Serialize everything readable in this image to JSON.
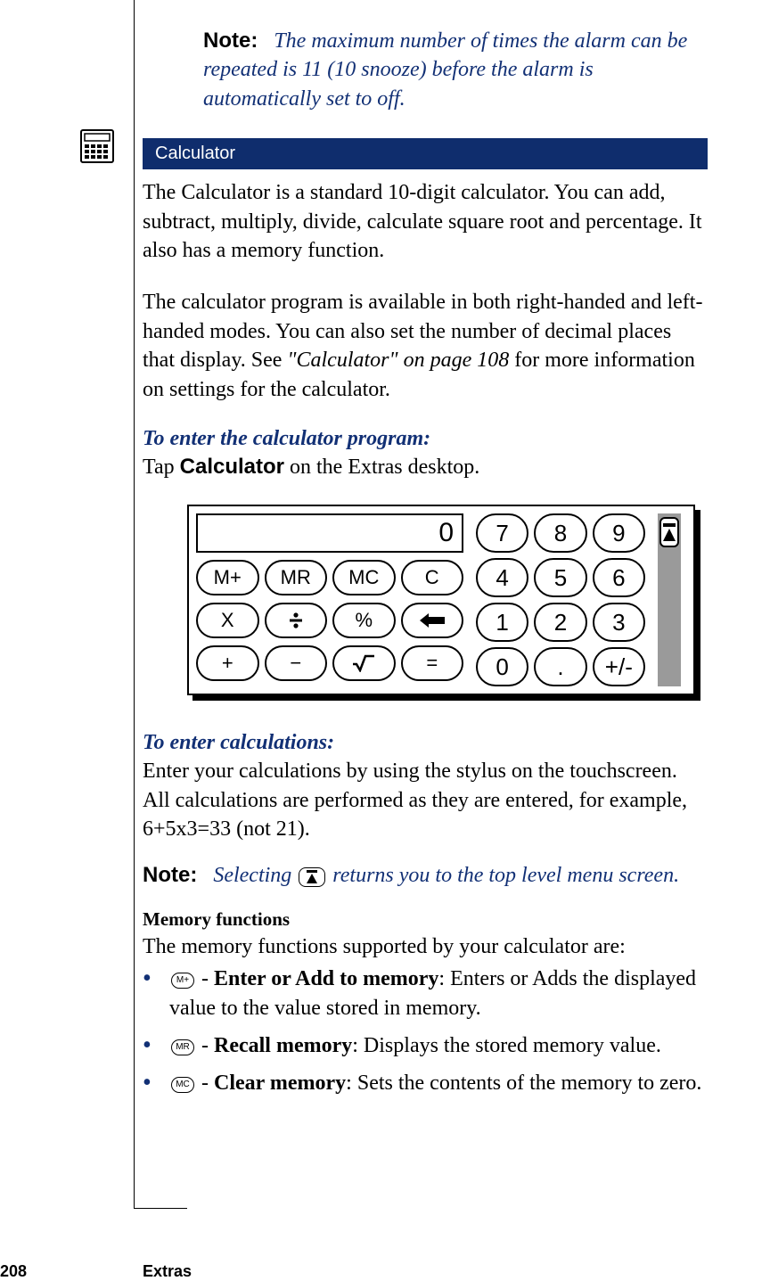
{
  "note1": {
    "label": "Note:",
    "text": "The maximum number of times the alarm can be repeated is 11 (10 snooze) before the alarm is automatically set to off."
  },
  "section": {
    "title": "Calculator"
  },
  "para1": "The Calculator is a standard 10-digit calculator. You can add, subtract, multiply, divide, calculate square root and percentage. It also has a memory function.",
  "para2_a": "The calculator program is available in both right-handed and left-handed modes. You can also set the number of decimal places that display. See ",
  "para2_ref": "\"Calculator\" on page 108",
  "para2_b": " for more information on settings for the calculator.",
  "sub1": "To enter the calculator program:",
  "instr1_a": "Tap ",
  "instr1_bold": "Calculator",
  "instr1_b": " on the Extras desktop.",
  "calc": {
    "display": "0",
    "row1": [
      "M+",
      "MR",
      "MC",
      "C"
    ],
    "row2_labels": [
      "multiply",
      "divide",
      "percent",
      "backspace"
    ],
    "row2_text": [
      "X",
      "",
      "%",
      ""
    ],
    "row3_labels": [
      "plus",
      "minus",
      "sqrt",
      "equals"
    ],
    "row3_text": [
      "+",
      "−",
      "",
      "="
    ],
    "numpad": [
      "7",
      "8",
      "9",
      "4",
      "5",
      "6",
      "1",
      "2",
      "3",
      "0",
      ".",
      "+/-"
    ]
  },
  "sub2": "To enter calculations:",
  "para3": "Enter your calculations by using the stylus on the touchscreen. All calculations are performed as they are entered, for example, 6+5x3=33 (not 21).",
  "note2": {
    "label": "Note:",
    "text_a": "Selecting ",
    "text_b": " returns you to the top level menu screen."
  },
  "memhead": "Memory functions",
  "memintro": "The memory functions supported by your calculator are:",
  "bullets": [
    {
      "key": "M+",
      "bold": "Enter or Add to memory",
      "rest": ": Enters or Adds the displayed value to the value stored in memory."
    },
    {
      "key": "MR",
      "bold": "Recall memory",
      "rest": ": Displays the stored memory value."
    },
    {
      "key": "MC",
      "bold": "Clear memory",
      "rest": ": Sets the contents of the memory to zero."
    }
  ],
  "footer": {
    "page": "208",
    "section": "Extras"
  }
}
